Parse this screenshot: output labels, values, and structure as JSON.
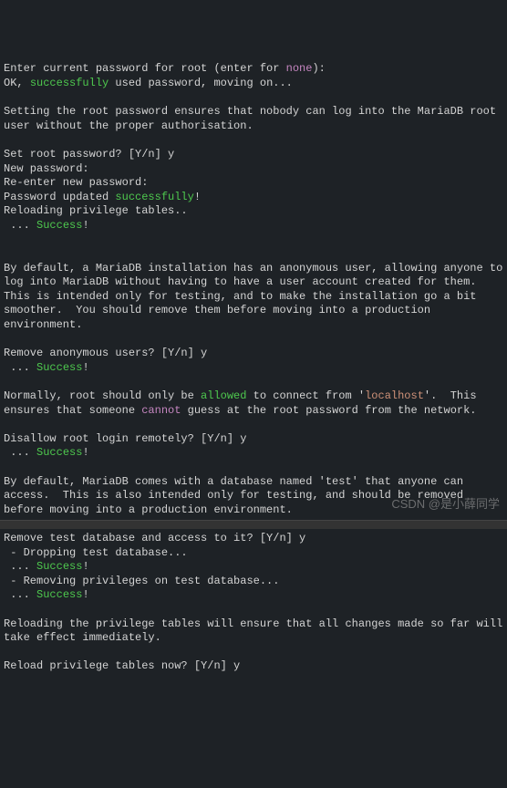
{
  "lines": [
    [
      [
        "Enter current password for root (enter for ",
        ""
      ],
      [
        "none",
        "magenta"
      ],
      [
        "):",
        ""
      ]
    ],
    [
      [
        "OK, ",
        ""
      ],
      [
        "successfully",
        "green"
      ],
      [
        " used password, moving on...",
        ""
      ]
    ],
    [
      [
        "",
        ""
      ]
    ],
    [
      [
        "Setting the root password ensures that nobody can log into the MariaDB root user without the proper authorisation.",
        ""
      ]
    ],
    [
      [
        "",
        ""
      ]
    ],
    [
      [
        "Set root password? [Y/n] y",
        ""
      ]
    ],
    [
      [
        "New password:",
        ""
      ]
    ],
    [
      [
        "Re-enter new password:",
        ""
      ]
    ],
    [
      [
        "Password updated ",
        ""
      ],
      [
        "successfully",
        "green"
      ],
      [
        "!",
        ""
      ]
    ],
    [
      [
        "Reloading privilege tables..",
        ""
      ]
    ],
    [
      [
        " ... ",
        ""
      ],
      [
        "Success",
        "green"
      ],
      [
        "!",
        ""
      ]
    ],
    [
      [
        "",
        ""
      ]
    ],
    [
      [
        "",
        ""
      ]
    ],
    [
      [
        "By default, a MariaDB installation has an anonymous user, allowing anyone to log into MariaDB without having to have a user account created for them.  This is intended only for testing, and to make the installation go a bit smoother.  You should remove them before moving into a production environment.",
        ""
      ]
    ],
    [
      [
        "",
        ""
      ]
    ],
    [
      [
        "Remove anonymous users? [Y/n] y",
        ""
      ]
    ],
    [
      [
        " ... ",
        ""
      ],
      [
        "Success",
        "green"
      ],
      [
        "!",
        ""
      ]
    ],
    [
      [
        "",
        ""
      ]
    ],
    [
      [
        "Normally, root should only be ",
        ""
      ],
      [
        "allowed",
        "green"
      ],
      [
        " to connect from '",
        ""
      ],
      [
        "localhost",
        "orange"
      ],
      [
        "'.  This ensures that someone ",
        ""
      ],
      [
        "cannot",
        "magenta"
      ],
      [
        " guess at the root password from the network.",
        ""
      ]
    ],
    [
      [
        "",
        ""
      ]
    ],
    [
      [
        "Disallow root login remotely? [Y/n] y",
        ""
      ]
    ],
    [
      [
        " ... ",
        ""
      ],
      [
        "Success",
        "green"
      ],
      [
        "!",
        ""
      ]
    ],
    [
      [
        "",
        ""
      ]
    ],
    [
      [
        "By default, MariaDB comes with a database named 'test' that anyone can access.  This is also intended only for testing, and should be removed before moving into a production environment.",
        ""
      ]
    ],
    [
      [
        "",
        ""
      ]
    ],
    [
      [
        "Remove test database and access to it? [Y/n] y",
        ""
      ]
    ],
    [
      [
        " - Dropping test database...",
        ""
      ]
    ],
    [
      [
        " ... ",
        ""
      ],
      [
        "Success",
        "green"
      ],
      [
        "!",
        ""
      ]
    ],
    [
      [
        " - Removing privileges on test database...",
        ""
      ]
    ],
    [
      [
        " ... ",
        ""
      ],
      [
        "Success",
        "green"
      ],
      [
        "!",
        ""
      ]
    ],
    [
      [
        "",
        ""
      ]
    ],
    [
      [
        "Reloading the privilege tables will ensure that all changes made so far will take effect immediately.",
        ""
      ]
    ],
    [
      [
        "",
        ""
      ]
    ],
    [
      [
        "Reload privilege tables now? [Y/n] y",
        ""
      ]
    ]
  ],
  "watermark": "CSDN @是小薛同学"
}
